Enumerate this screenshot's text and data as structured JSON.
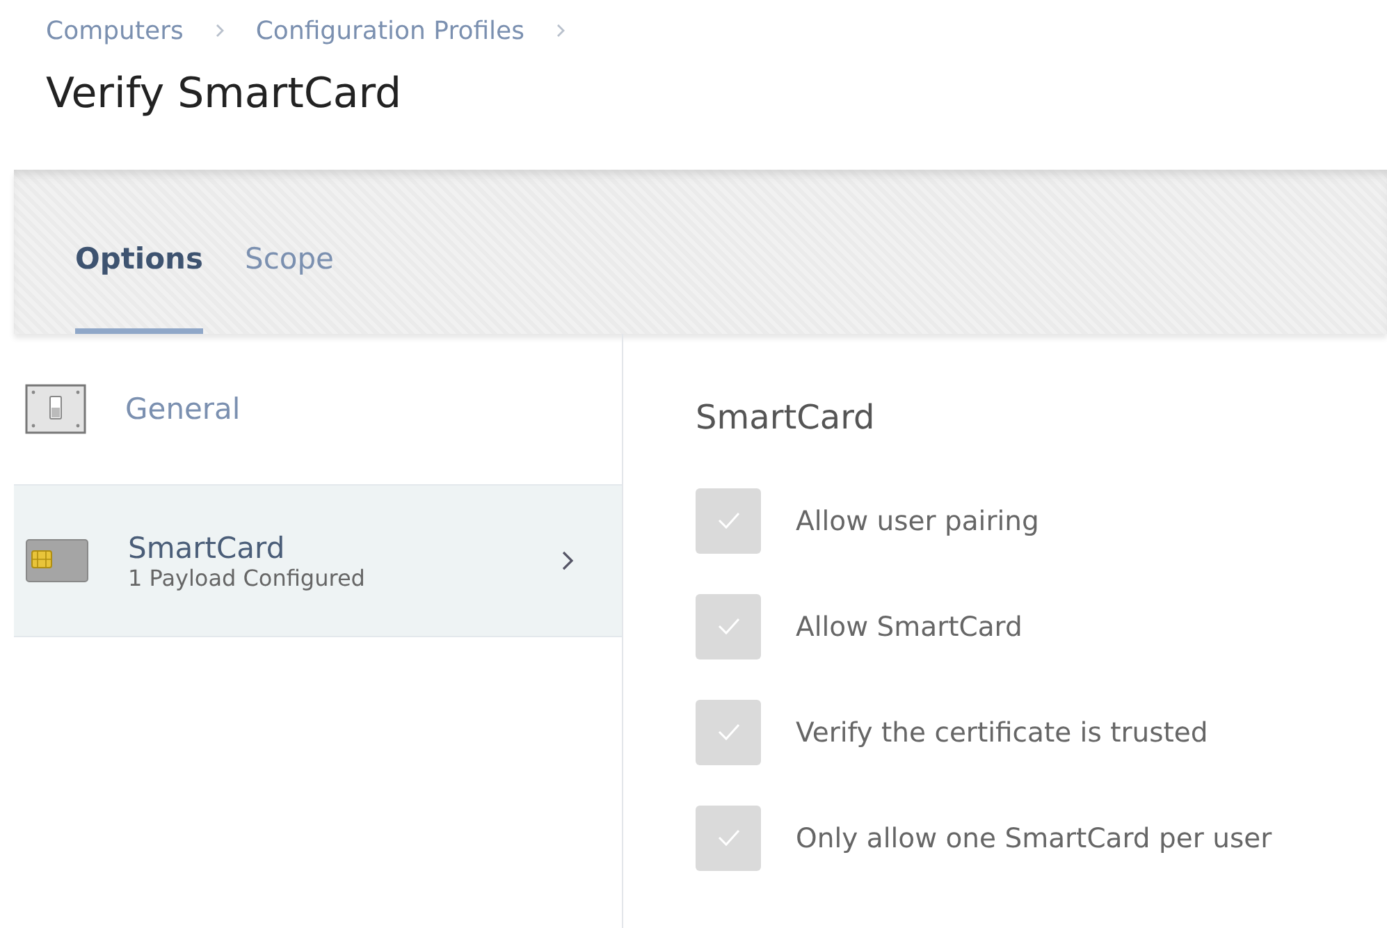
{
  "breadcrumb": [
    "Computers",
    "Configuration Profiles"
  ],
  "title": "Verify SmartCard",
  "tabs": [
    {
      "label": "Options",
      "selected": true
    },
    {
      "label": "Scope",
      "selected": false
    }
  ],
  "payloads": [
    {
      "name": "General",
      "selected": false
    },
    {
      "name": "SmartCard",
      "subtitle": "1 Payload Configured",
      "selected": true
    }
  ],
  "section": {
    "heading": "SmartCard",
    "options": [
      {
        "label": "Allow user pairing",
        "checked": true,
        "disabled": true
      },
      {
        "label": "Allow SmartCard",
        "checked": true,
        "disabled": true
      },
      {
        "label": "Verify the certificate is trusted",
        "checked": true,
        "disabled": true
      },
      {
        "label": "Only allow one SmartCard per user",
        "checked": true,
        "disabled": true
      }
    ]
  }
}
